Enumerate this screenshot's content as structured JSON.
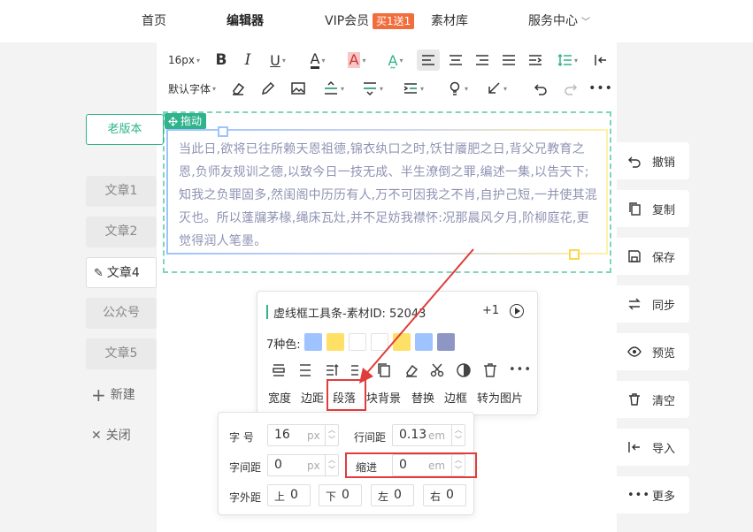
{
  "nav": {
    "items": [
      {
        "label": "首页"
      },
      {
        "label": "编辑器"
      },
      {
        "label": "VIP会员"
      },
      {
        "label": "素材库"
      },
      {
        "label": "服务中心"
      }
    ],
    "badge": "买1送1"
  },
  "toolbar": {
    "font_size": "16px",
    "font_family": "默认字体"
  },
  "drag_tag": "拖动",
  "content_text": "当此日,欲将已往所赖天恩祖德,锦衣纨口之时,饫甘餍肥之日,背父兄教育之恩,负师友规训之德,以致今日一技无成、半生潦倒之罪,编述一集,以告天下;知我之负罪固多,然闺阁中历历有人,万不可因我之不肖,自护己短,一并使其混灭也。所以蓬牖茅椽,绳床瓦灶,并不足妨我襟怀:况那晨风夕月,阶柳庭花,更觉得润人笔墨。",
  "left": {
    "old_version": "老版本",
    "articles": [
      "文章1",
      "文章2",
      "文章4",
      "公众号",
      "文章5"
    ],
    "new": "新建",
    "close": "关闭"
  },
  "right": {
    "actions": [
      {
        "label": "撤销",
        "icon": "undo-icon"
      },
      {
        "label": "复制",
        "icon": "copy-icon"
      },
      {
        "label": "保存",
        "icon": "save-icon"
      },
      {
        "label": "同步",
        "icon": "sync-icon"
      },
      {
        "label": "预览",
        "icon": "eye-icon"
      },
      {
        "label": "清空",
        "icon": "trash-icon"
      },
      {
        "label": "导入",
        "icon": "import-icon"
      },
      {
        "label": "更多",
        "icon": "more-icon"
      }
    ]
  },
  "material": {
    "title": "虚线框工具条-素材ID: 52043",
    "plus": "+1",
    "colors_label": "7种色:",
    "colors": [
      "#9ec3ff",
      "#ffe066",
      "#ffffff",
      "#ffffff",
      "#ffe066",
      "#9ec3ff",
      "#8e97c4"
    ],
    "tools": [
      "宽度",
      "边距",
      "段落",
      "块背景",
      "替换",
      "边框",
      "转为图片"
    ]
  },
  "paragraph": {
    "font_size_label": "字  号",
    "font_size_value": "16",
    "font_size_unit": "px",
    "line_height_label": "行间距",
    "line_height_value": "0.13",
    "line_height_unit": "em",
    "letter_spacing_label": "字间距",
    "letter_spacing_value": "0",
    "letter_spacing_unit": "px",
    "indent_label": "缩进",
    "indent_value": "0",
    "indent_unit": "em",
    "margin_label": "字外距",
    "margins": [
      {
        "label": "上",
        "value": "0"
      },
      {
        "label": "下",
        "value": "0"
      },
      {
        "label": "左",
        "value": "0"
      },
      {
        "label": "右",
        "value": "0"
      }
    ]
  },
  "accent_color": "#2fb38b",
  "highlight_color": "#e03c3c"
}
